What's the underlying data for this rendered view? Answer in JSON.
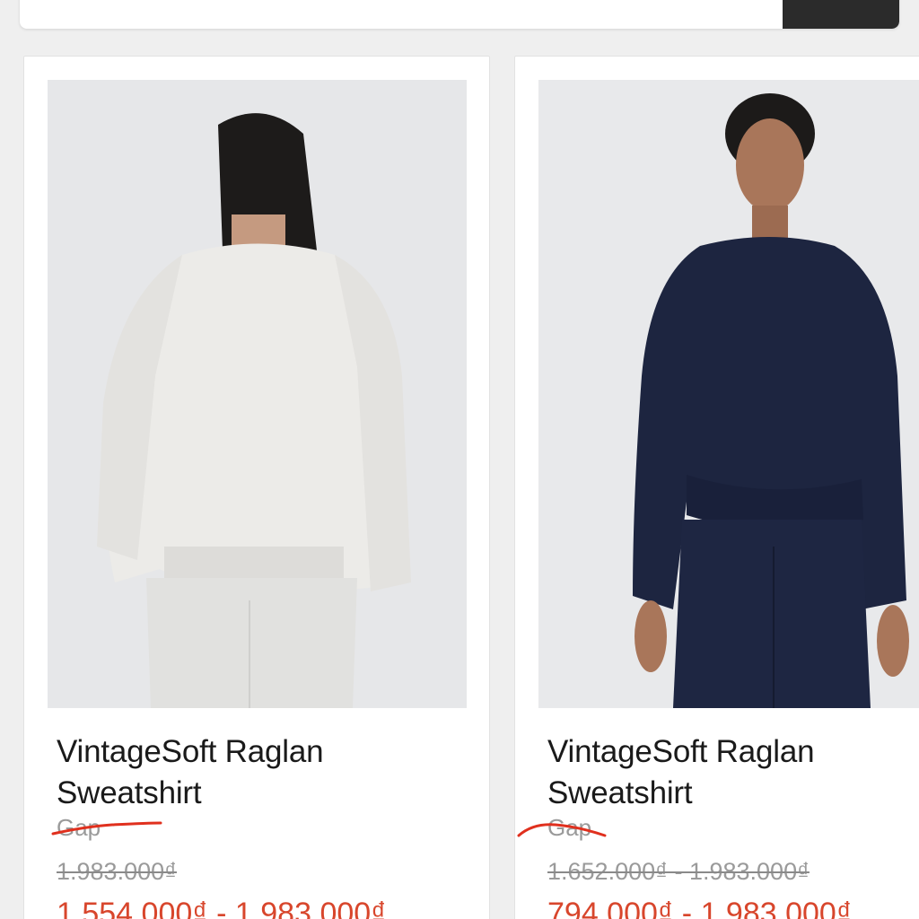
{
  "products": [
    {
      "name_line1": "VintageSoft Raglan",
      "name_line2": "Sweatshirt",
      "brand": "Gap",
      "old_price": "1.983.000₫",
      "sale_price": "1.554.000₫ - 1.983.000₫",
      "image": "model-back-heather-grey-sweatshirt"
    },
    {
      "name_line1": "VintageSoft Raglan",
      "name_line2": "Sweatshirt",
      "brand": "Gap",
      "old_price": "1.652.000₫ - 1.983.000₫",
      "sale_price": "794.000₫ - 1.983.000₫",
      "image": "model-front-navy-sweatshirt"
    }
  ],
  "colors": {
    "sale": "#d8462c",
    "muted": "#9a9a9a",
    "annotation": "#e0301e",
    "search_button": "#2b2b2b"
  }
}
